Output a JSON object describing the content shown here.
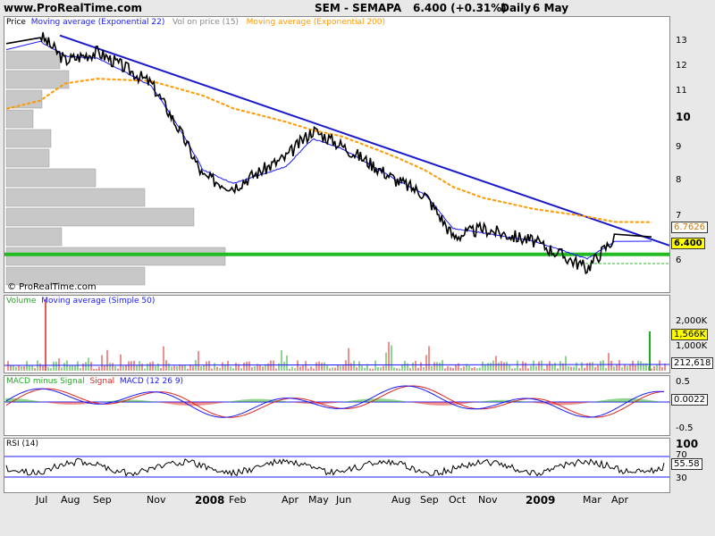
{
  "header": {
    "site": "www.ProRealTime.com",
    "instrument": "SEM - SEMAPA",
    "quote": "6.400 (+0.31%)",
    "period": "Daily",
    "date": "6 May"
  },
  "colors": {
    "price": "#000000",
    "ema22": "#1a1aff",
    "ema200": "#ff9900",
    "trendline": "#1a1acc",
    "support": "#22bb22",
    "macd_pos": "#22aa22",
    "macd_neg": "#dd2222"
  },
  "price_panel": {
    "legend": [
      "Price",
      "Moving average (Exponential 22)",
      "Vol on price (15)",
      "Moving average (Exponential 200)"
    ],
    "watermark": "© ProRealTime.com",
    "y_ticks": [
      "13",
      "12",
      "11",
      "10",
      "9",
      "8",
      "7",
      "6"
    ],
    "label_ema200": "6.7626",
    "label_price": "6.400"
  },
  "volume_panel": {
    "legend": [
      "Volume",
      "Moving average (Simple 50)"
    ],
    "y_ticks": [
      "2,000K",
      "1,000K"
    ],
    "label_last": "1,566K",
    "label_ma": "212,618"
  },
  "macd_panel": {
    "legend": [
      "MACD minus Signal",
      "Signal",
      "MACD (12 26 9)"
    ],
    "y_ticks": [
      "0.5",
      "0.0022",
      "-0.5"
    ],
    "label_last": "0.0022"
  },
  "rsi_panel": {
    "legend": [
      "RSI (14)"
    ],
    "y_ticks": [
      "100",
      "70",
      "30"
    ],
    "label_last": "55.58"
  },
  "x_axis": [
    "Jul",
    "Aug",
    "Sep",
    "Nov",
    "2008",
    "Feb",
    "Apr",
    "May",
    "Jun",
    "Aug",
    "Sep",
    "Oct",
    "Nov",
    "2009",
    "Mar",
    "Apr"
  ],
  "chart_data": {
    "type": "line",
    "title": "SEM - SEMAPA",
    "x": [
      "Jul",
      "Aug",
      "Sep",
      "Nov",
      "2008",
      "Feb",
      "Apr",
      "May",
      "Jun",
      "Aug",
      "Sep",
      "Oct",
      "Nov",
      "2009",
      "Mar",
      "Apr"
    ],
    "series": [
      {
        "name": "Price",
        "values": [
          13.5,
          12.3,
          12.7,
          11.3,
          8.0,
          7.7,
          8.6,
          9.5,
          9.0,
          7.9,
          7.5,
          6.4,
          6.6,
          6.3,
          5.7,
          6.4
        ]
      },
      {
        "name": "Moving average (Exponential 22)",
        "values": [
          13.2,
          12.5,
          12.4,
          11.2,
          8.2,
          7.8,
          8.3,
          9.2,
          8.9,
          7.9,
          7.5,
          6.6,
          6.5,
          6.3,
          5.9,
          6.3
        ]
      },
      {
        "name": "Moving average (Exponential 200)",
        "values": [
          10.6,
          11.3,
          11.5,
          11.4,
          10.8,
          10.3,
          9.8,
          9.5,
          9.3,
          8.6,
          8.2,
          7.7,
          7.4,
          7.1,
          6.9,
          6.76
        ]
      }
    ],
    "ylim": [
      5.5,
      13.8
    ],
    "y_scale": "log",
    "grid": false,
    "legend_position": "top-left"
  }
}
